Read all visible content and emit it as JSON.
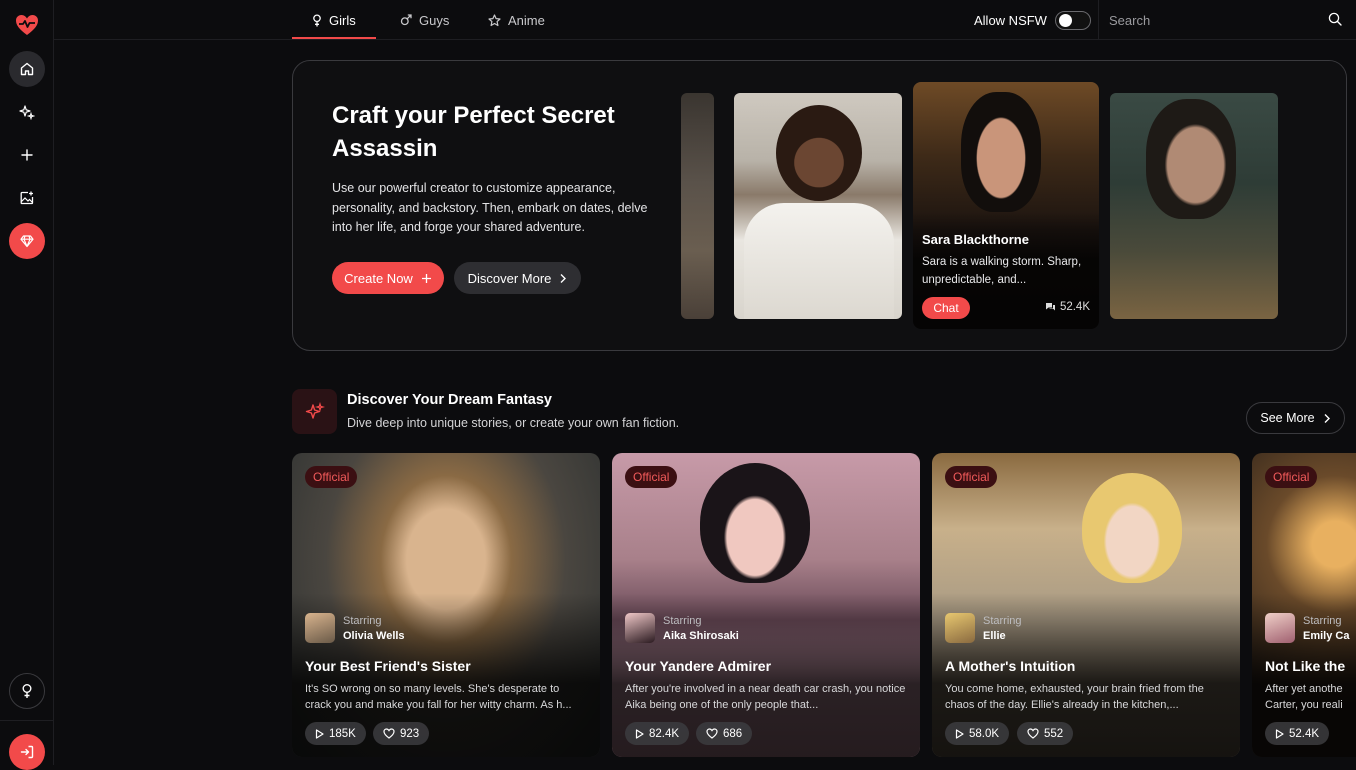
{
  "colors": {
    "accent": "#f24a4a",
    "background": "#0c0c0e",
    "badge_bg": "#3b0f12",
    "badge_text": "#f25a5a"
  },
  "sidebar": {
    "logo_icon": "heart-pulse-icon",
    "items": [
      {
        "name": "home",
        "icon": "home-icon"
      },
      {
        "name": "discover",
        "icon": "sparkles-icon"
      },
      {
        "name": "create",
        "icon": "plus-icon"
      },
      {
        "name": "generate-image",
        "icon": "image-plus-icon"
      },
      {
        "name": "premium",
        "icon": "diamond-icon"
      }
    ],
    "bottom": [
      {
        "name": "gender",
        "icon": "female-icon"
      },
      {
        "name": "login",
        "icon": "login-icon"
      }
    ]
  },
  "topbar": {
    "tabs": [
      {
        "label": "Girls",
        "icon": "female-icon",
        "active": true
      },
      {
        "label": "Guys",
        "icon": "male-icon",
        "active": false
      },
      {
        "label": "Anime",
        "icon": "star-icon",
        "active": false
      }
    ],
    "nsfw_label": "Allow NSFW",
    "nsfw_enabled": false,
    "search_placeholder": "Search"
  },
  "hero": {
    "title": "Craft your Perfect Secret Assassin",
    "description": "Use our powerful creator to customize appearance, personality, and backstory. Then, embark on dates, delve into her life, and forge your shared adventure.",
    "create_label": "Create Now",
    "discover_label": "Discover More",
    "featured": {
      "name": "Sara Blackthorne",
      "description": "Sara is a walking storm. Sharp, unpredictable, and...",
      "chat_label": "Chat",
      "chat_count": "52.4K"
    }
  },
  "section": {
    "title": "Discover Your Dream Fantasy",
    "subtitle": "Dive deep into unique stories, or create your own fan fiction.",
    "see_more": "See More",
    "cards": [
      {
        "badge": "Official",
        "starring_label": "Starring",
        "character": "Olivia Wells",
        "title": "Your Best Friend's Sister",
        "description": "It's SO wrong on so many levels. She's desperate to crack you and make you fall for her witty charm. As h...",
        "plays": "185K",
        "likes": "923"
      },
      {
        "badge": "Official",
        "starring_label": "Starring",
        "character": "Aika Shirosaki",
        "title": "Your Yandere Admirer",
        "description": "After you're involved in a near death car crash, you notice Aika being one of the only people that...",
        "plays": "82.4K",
        "likes": "686"
      },
      {
        "badge": "Official",
        "starring_label": "Starring",
        "character": "Ellie",
        "title": "A Mother's Intuition",
        "description": "You come home, exhausted, your brain fried from the chaos of the day. Ellie's already in the kitchen,...",
        "plays": "58.0K",
        "likes": "552"
      },
      {
        "badge": "Official",
        "starring_label": "Starring",
        "character": "Emily Ca",
        "title": "Not Like the",
        "description": "After yet anothe Carter, you reali",
        "plays": "52.4K",
        "likes": ""
      }
    ]
  }
}
